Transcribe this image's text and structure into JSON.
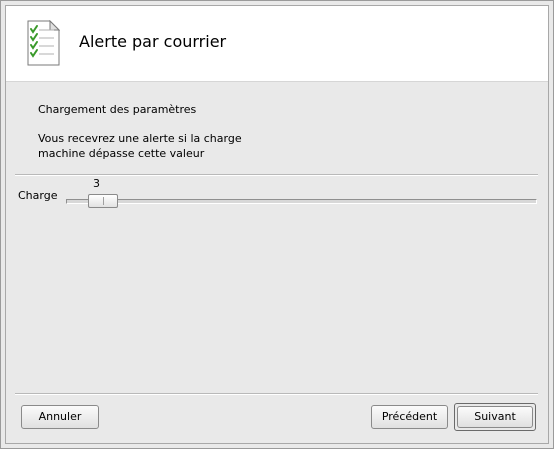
{
  "header": {
    "title": "Alerte par courrier",
    "icon": "checklist-document-icon"
  },
  "content": {
    "section_title": "Chargement des paramètres",
    "description_line1": "Vous recevrez une alerte si la charge",
    "description_line2": "machine dépasse cette valeur"
  },
  "slider": {
    "label": "Charge",
    "value": "3",
    "min": 0,
    "max": 100,
    "position_fraction": 0.05
  },
  "buttons": {
    "cancel_label": "Annuler",
    "previous_label": "Précédent",
    "next_label": "Suivant"
  },
  "colors": {
    "background": "#e9e9e9",
    "header_background": "#ffffff",
    "check_green": "#3a9a2a"
  }
}
